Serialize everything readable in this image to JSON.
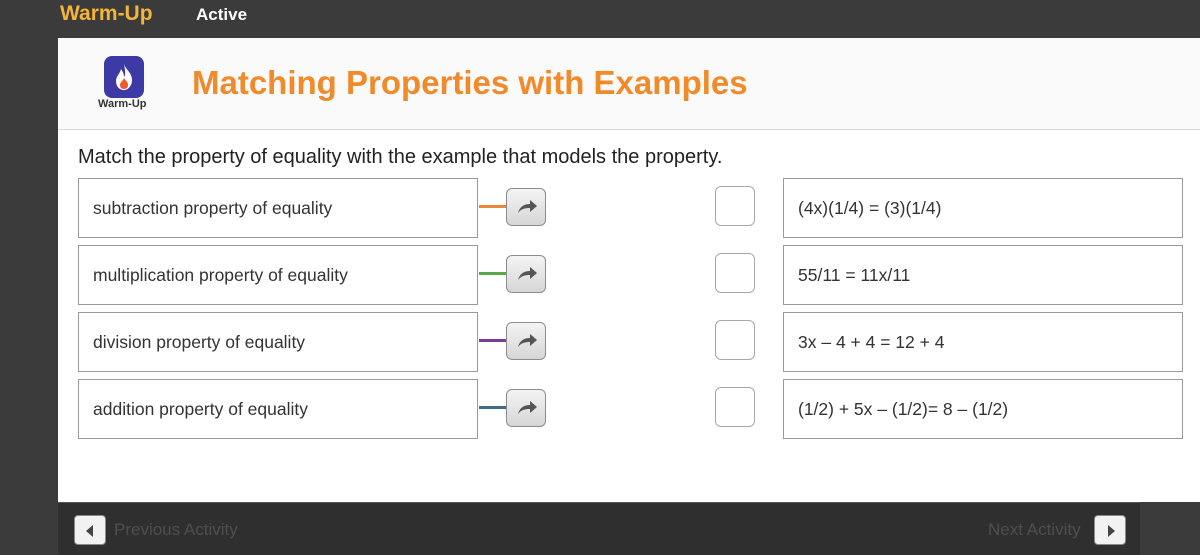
{
  "topbar": {
    "brand": "Warm-Up",
    "status": "Active"
  },
  "header": {
    "logo_caption": "Warm-Up",
    "title": "Matching Properties with Examples"
  },
  "instruction": "Match the property of equality with the example that models the property.",
  "properties": [
    {
      "label": "subtraction property of equality",
      "color": "#e8873a"
    },
    {
      "label": "multiplication property of equality",
      "color": "#5aa846"
    },
    {
      "label": "division property of equality",
      "color": "#7a3a9e"
    },
    {
      "label": "addition property of equality",
      "color": "#3a6f85"
    }
  ],
  "examples": [
    {
      "label": "(4x)(1/4) = (3)(1/4)"
    },
    {
      "label": "55/11 = 11x/11"
    },
    {
      "label": "3x – 4 + 4 = 12 + 4"
    },
    {
      "label": "(1/2) + 5x – (1/2)= 8 – (1/2)"
    }
  ],
  "footer": {
    "prev_label": "Previous Activity",
    "next_label": "Next Activity"
  },
  "icons": {
    "logo": "flame-icon",
    "arrow": "curved-arrow-icon",
    "prev": "triangle-left-icon",
    "next": "triangle-right-icon"
  }
}
